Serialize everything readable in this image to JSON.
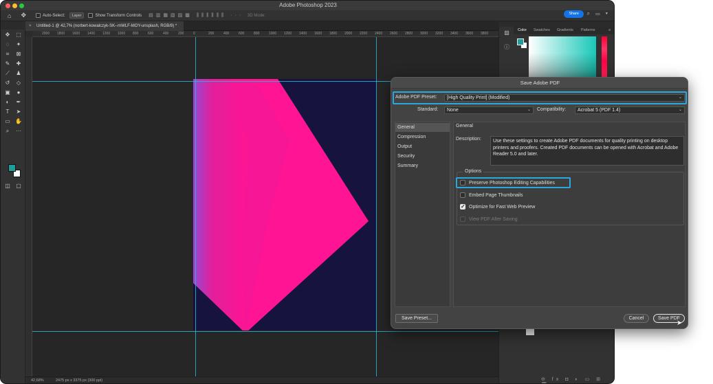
{
  "window": {
    "title": "Adobe Photoshop 2023"
  },
  "options_bar": {
    "auto_select_label": "Auto-Select:",
    "auto_select_value": "Layer",
    "show_transform_label": "Show Transform Controls",
    "mode_3d_label": "3D Mode:",
    "share_label": "Share"
  },
  "document": {
    "tab_title": "Untitled-1 @ 42,7% (norbert-kowalczyk-SK--mWLF-MOY-unsplash, RGB/8) *",
    "close_symbol": "×",
    "zoom": "42,68%",
    "dimensions": "2475 px x 3375 px (300 ppi)",
    "canvas_bg": "#16143f",
    "shape_color": "#ff1493"
  },
  "ruler": {
    "top_labels": [
      "2000",
      "1800",
      "1600",
      "1400",
      "1200",
      "1000",
      "800",
      "600",
      "400",
      "200",
      "0",
      "200",
      "400",
      "600",
      "800",
      "1000",
      "1200",
      "1400",
      "1600",
      "1800",
      "2000",
      "2200",
      "2400",
      "2600",
      "2800",
      "3000",
      "3200",
      "3400",
      "3600",
      "3800"
    ]
  },
  "panel": {
    "tabs": [
      "Color",
      "Swatches",
      "Gradients",
      "Patterns"
    ],
    "fg_color": "#1f9d9a"
  },
  "dialog": {
    "title": "Save Adobe PDF",
    "preset_label": "Adobe PDF Preset:",
    "preset_value": "[High Quality Print] (Modified)",
    "standard_label": "Standard:",
    "standard_value": "None",
    "compat_label": "Compatibility:",
    "compat_value": "Acrobat 5 (PDF 1.4)",
    "categories": [
      "General",
      "Compression",
      "Output",
      "Security",
      "Summary"
    ],
    "selected_category": "General",
    "section_title": "General",
    "description_label": "Description:",
    "description_text": "Use these settings to create Adobe PDF documents for quality printing on desktop printers and proofers.  Created PDF documents can be opened with Acrobat and Adobe Reader 5.0 and later.",
    "options_legend": "Options",
    "options": [
      {
        "label": "Preserve Photoshop Editing Capabilities",
        "checked": false,
        "disabled": false
      },
      {
        "label": "Embed Page Thumbnails",
        "checked": false,
        "disabled": false
      },
      {
        "label": "Optimize for Fast Web Preview",
        "checked": true,
        "disabled": false
      },
      {
        "label": "View PDF After Saving",
        "checked": false,
        "disabled": true
      }
    ],
    "save_preset_label": "Save Preset...",
    "cancel_label": "Cancel",
    "save_pdf_label": "Save PDF",
    "highlight_color": "#2aa9e0"
  }
}
